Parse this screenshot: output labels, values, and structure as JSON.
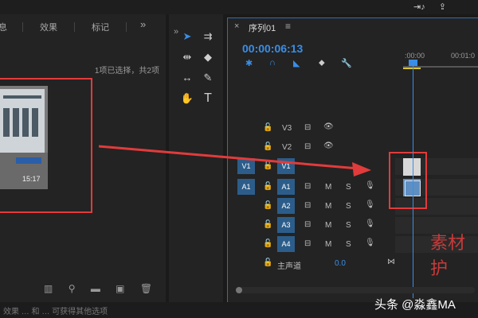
{
  "app": {
    "left_tabs": [
      "息",
      "效果",
      "标记"
    ],
    "left_tab_more": "»",
    "selection_info": "1项已选择，共2项",
    "thumb_duration": "15:17",
    "bottom_icons": [
      "list-view-icon",
      "search-icon",
      "folder-icon",
      "new-item-icon",
      "trash-icon"
    ]
  },
  "tools": [
    {
      "name": "selection-tool-icon",
      "glyph": "➤"
    },
    {
      "name": "track-select-tool-icon",
      "glyph": "⇉"
    },
    {
      "name": "ripple-edit-tool-icon",
      "glyph": "⇹"
    },
    {
      "name": "razor-tool-icon",
      "glyph": "◆"
    },
    {
      "name": "slip-tool-icon",
      "glyph": "↔"
    },
    {
      "name": "pen-tool-icon",
      "glyph": "✎"
    },
    {
      "name": "hand-tool-icon",
      "glyph": "✋"
    },
    {
      "name": "type-tool-icon",
      "glyph": "T"
    }
  ],
  "timeline": {
    "close": "×",
    "sequence_name": "序列01",
    "menu": "≡",
    "timecode": "00:00:06:13",
    "ruler_labels": [
      ":00:00",
      "00:01:0"
    ],
    "master_label": "主声道",
    "master_value": "0.0",
    "video_tracks": [
      {
        "label": "V3",
        "lock": "🔓"
      },
      {
        "label": "V2",
        "lock": "🔓"
      },
      {
        "label": "V1",
        "lock": "🔓",
        "source": "V1"
      }
    ],
    "audio_tracks": [
      {
        "label": "A1",
        "lock": "🔓",
        "source": "A1"
      },
      {
        "label": "A2",
        "lock": "🔓"
      },
      {
        "label": "A3",
        "lock": "🔓"
      },
      {
        "label": "A4",
        "lock": "🔓"
      }
    ],
    "ms_labels": [
      "M",
      "S"
    ]
  },
  "annotation": {
    "red_text": "素材护"
  },
  "status": {
    "text": "效果 … 和 … 可获得其他选项"
  },
  "watermark": {
    "text": "头条 @淼鑫MA"
  },
  "colors": {
    "accent": "#3a8ee6",
    "track_highlight": "#2c5d8a",
    "annotation_red": "#e23b3b"
  }
}
